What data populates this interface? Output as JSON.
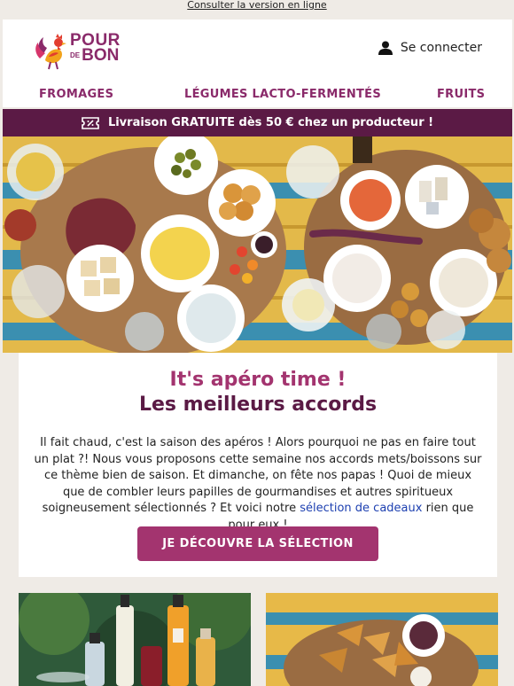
{
  "topbar": {
    "online_link": "Consulter la version en ligne"
  },
  "header": {
    "logo": {
      "line1": "POUR",
      "small": "DE",
      "line2": "BON"
    },
    "login_label": "Se connecter"
  },
  "nav": {
    "items": [
      {
        "label": "FROMAGES"
      },
      {
        "label": "LÉGUMES LACTO-FERMENTÉS"
      },
      {
        "label": "FRUITS"
      }
    ]
  },
  "banner": {
    "text": "Livraison GRATUITE dès 50 € chez un producteur !",
    "icon": "delivery-ticket-icon"
  },
  "hero": {
    "image": "apero-table-photo"
  },
  "main": {
    "title_line1": "It's apéro time !",
    "title_line2": "Les meilleurs accords",
    "body_before_link": "Il fait chaud, c'est la saison des apéros ! Alors pourquoi ne pas en faire tout un plat ?! Nous vous proposons cette semaine nos accords mets/boissons sur ce thème bien de saison. Et dimanche, on fête nos papas ! Quoi de mieux que de combler leurs papilles de gourmandises et autres spiritueux soigneusement sélectionnés ? Et voici notre ",
    "link_text": "sélection de cadeaux",
    "body_after_link": " rien que pour eux !",
    "cta_label": "JE DÉCOUVRE LA SÉLECTION"
  },
  "colors": {
    "brand_plum": "#5b1a45",
    "brand_pink": "#a3346f",
    "link_blue": "#1c3fb0",
    "background": "#efebe6"
  }
}
